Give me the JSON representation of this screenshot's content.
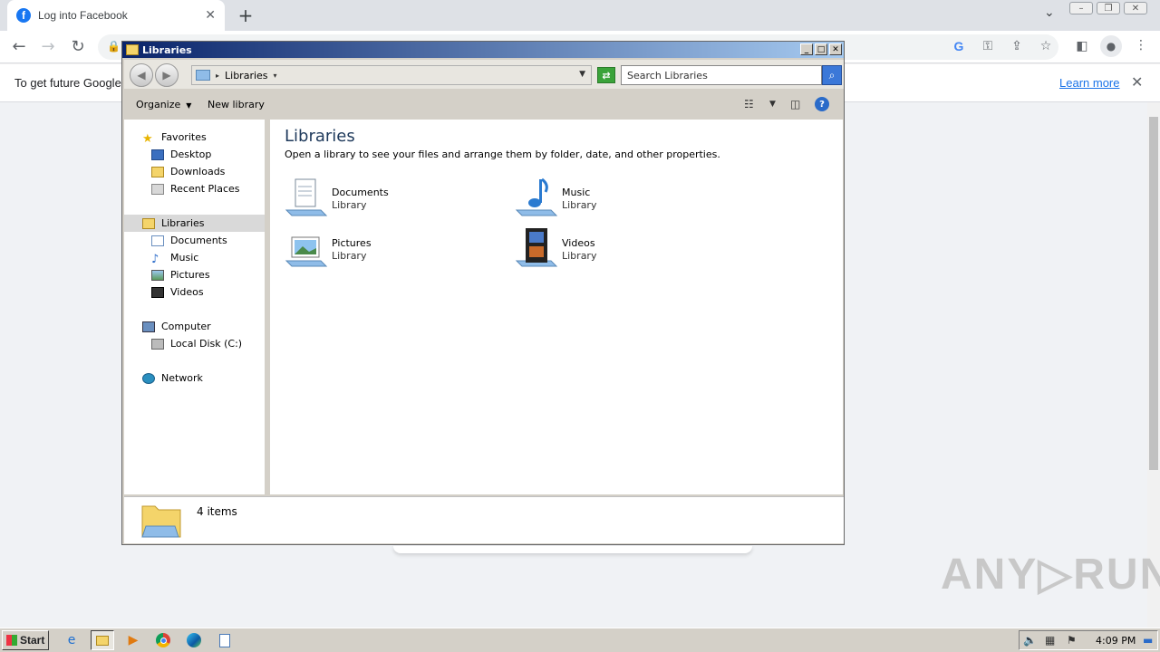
{
  "browser": {
    "tab_title": "Log into Facebook",
    "tab_favicon": "f",
    "new_tab": "+",
    "tab_close": "✕",
    "infobar_message": "To get future Google",
    "learn_more": "Learn more",
    "infobar_close": "✕"
  },
  "explorer": {
    "window_title": "Libraries",
    "breadcrumb": "Libraries",
    "search_placeholder": "Search Libraries",
    "organize": "Organize",
    "new_library": "New library",
    "heading": "Libraries",
    "description": "Open a library to see your files and arrange them by folder, date, and other properties.",
    "nav": [
      {
        "label": "Favorites",
        "level": 0
      },
      {
        "label": "Desktop",
        "level": 1
      },
      {
        "label": "Downloads",
        "level": 1
      },
      {
        "label": "Recent Places",
        "level": 1
      },
      {
        "label": "Libraries",
        "level": 0
      },
      {
        "label": "Documents",
        "level": 1
      },
      {
        "label": "Music",
        "level": 1
      },
      {
        "label": "Pictures",
        "level": 1
      },
      {
        "label": "Videos",
        "level": 1
      },
      {
        "label": "Computer",
        "level": 0
      },
      {
        "label": "Local Disk (C:)",
        "level": 1
      },
      {
        "label": "Network",
        "level": 0
      }
    ],
    "libraries": [
      {
        "name": "Documents",
        "sub": "Library",
        "icon": "documents-library-icon"
      },
      {
        "name": "Music",
        "sub": "Library",
        "icon": "music-library-icon"
      },
      {
        "name": "Pictures",
        "sub": "Library",
        "icon": "pictures-library-icon"
      },
      {
        "name": "Videos",
        "sub": "Library",
        "icon": "videos-library-icon"
      }
    ],
    "item_count": "4 items"
  },
  "watermark": "ANY▷RUN",
  "taskbar": {
    "start": "Start",
    "clock": "4:09 PM"
  }
}
